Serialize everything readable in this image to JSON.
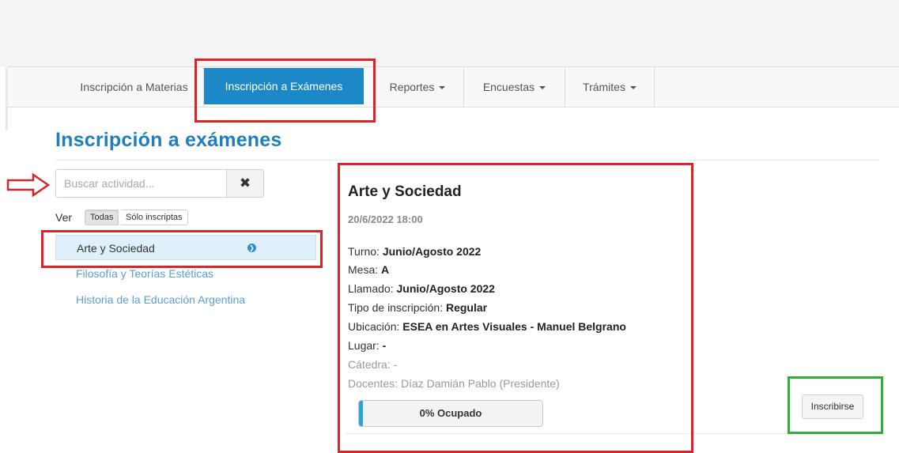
{
  "nav": {
    "items": [
      {
        "label": "Inscripción a Materias"
      },
      {
        "label": "Inscripción a Exámenes"
      },
      {
        "label": "Reportes"
      },
      {
        "label": "Encuestas"
      },
      {
        "label": "Trámites"
      }
    ]
  },
  "page": {
    "title": "Inscripción a exámenes"
  },
  "search": {
    "placeholder": "Buscar actividad...",
    "value": "",
    "clear_icon": "times-icon"
  },
  "filter": {
    "label": "Ver",
    "options": [
      "Todas",
      "Sólo inscriptas"
    ],
    "selected": "Todas"
  },
  "list": {
    "items": [
      {
        "label": "Arte y Sociedad",
        "selected": true
      },
      {
        "label": "Filosofía y Teorías Estéticas",
        "selected": false
      },
      {
        "label": "Historia de la Educación Argentina",
        "selected": false
      }
    ]
  },
  "detail": {
    "title": "Arte y Sociedad",
    "datetime": "20/6/2022 18:00",
    "turno": {
      "label": "Turno:",
      "value": "Junio/Agosto 2022"
    },
    "mesa": {
      "label": "Mesa:",
      "value": "A"
    },
    "llamado": {
      "label": "Llamado:",
      "value": "Junio/Agosto 2022"
    },
    "tipo": {
      "label": "Tipo de inscripción:",
      "value": "Regular"
    },
    "ubicacion": {
      "label": "Ubicación:",
      "value": "ESEA en Artes Visuales - Manuel Belgrano"
    },
    "lugar": {
      "label": "Lugar:",
      "value": "-"
    },
    "catedra": {
      "label": "Cátedra:",
      "value": "-"
    },
    "docentes": {
      "label": "Docentes:",
      "value": "Díaz Damián Pablo (Presidente)"
    },
    "ocupacion": {
      "label": "0% Ocupado",
      "fraction": 0.0
    }
  },
  "actions": {
    "inscribirse": "Inscribirse"
  },
  "colors": {
    "accent": "#1d88c7",
    "title": "#1d7fbf",
    "highlight_red": "#d6262c",
    "highlight_green": "#2fae3c"
  }
}
